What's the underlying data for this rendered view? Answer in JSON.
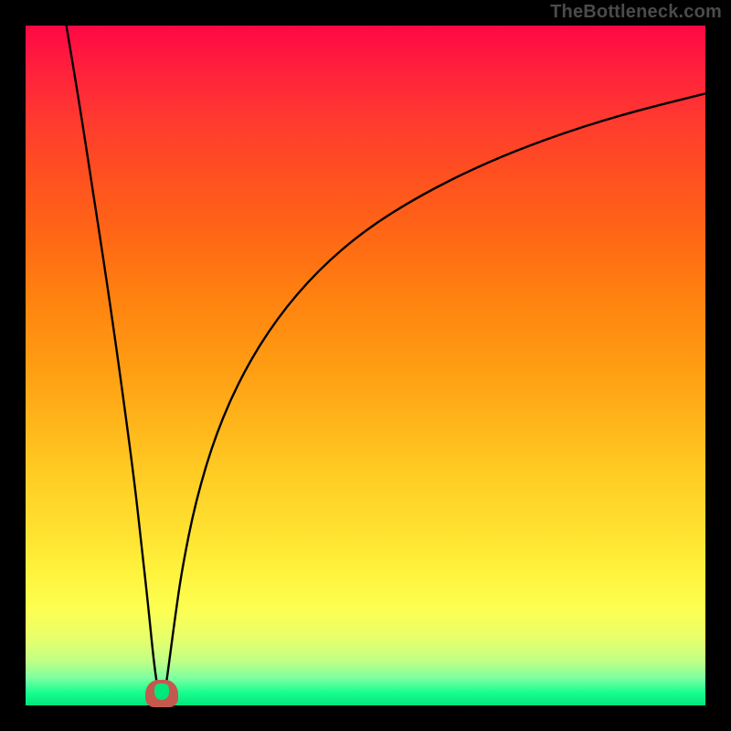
{
  "watermark": "TheBottleneck.com",
  "colors": {
    "frame_border": "#000000",
    "curve_stroke": "#000000",
    "nub_outline": "#c4584f",
    "nub_fill": "#00e77a"
  },
  "chart_data": {
    "type": "line",
    "title": "",
    "xlabel": "",
    "ylabel": "",
    "xlim": [
      0,
      100
    ],
    "ylim": [
      0,
      100
    ],
    "grid": false,
    "legend": false,
    "minimum_x": 20,
    "series": [
      {
        "name": "left-branch",
        "x": [
          6,
          8,
          10,
          12,
          14,
          16,
          17,
          18,
          18.8,
          19.4,
          20
        ],
        "y": [
          100,
          88,
          75,
          62,
          48,
          33,
          24,
          15,
          7,
          2.5,
          0
        ]
      },
      {
        "name": "right-branch",
        "x": [
          20,
          20.6,
          21.2,
          22,
          23,
          25,
          28,
          32,
          37,
          43,
          50,
          58,
          67,
          77,
          88,
          100
        ],
        "y": [
          0,
          2.5,
          7,
          13,
          20,
          30,
          40,
          49,
          57,
          64,
          70,
          75,
          79.5,
          83.5,
          87,
          90
        ]
      }
    ],
    "annotations": [
      {
        "type": "marker",
        "name": "minimum-nub",
        "x": 20,
        "y": 0
      }
    ]
  }
}
